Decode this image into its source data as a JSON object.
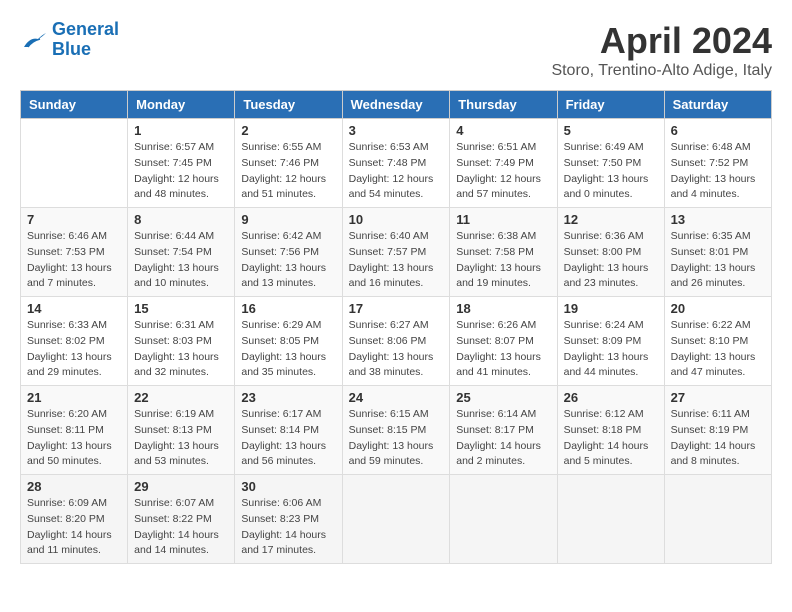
{
  "header": {
    "logo_line1": "General",
    "logo_line2": "Blue",
    "title": "April 2024",
    "subtitle": "Storo, Trentino-Alto Adige, Italy"
  },
  "weekdays": [
    "Sunday",
    "Monday",
    "Tuesday",
    "Wednesday",
    "Thursday",
    "Friday",
    "Saturday"
  ],
  "weeks": [
    [
      {
        "day": "",
        "info": ""
      },
      {
        "day": "1",
        "info": "Sunrise: 6:57 AM\nSunset: 7:45 PM\nDaylight: 12 hours\nand 48 minutes."
      },
      {
        "day": "2",
        "info": "Sunrise: 6:55 AM\nSunset: 7:46 PM\nDaylight: 12 hours\nand 51 minutes."
      },
      {
        "day": "3",
        "info": "Sunrise: 6:53 AM\nSunset: 7:48 PM\nDaylight: 12 hours\nand 54 minutes."
      },
      {
        "day": "4",
        "info": "Sunrise: 6:51 AM\nSunset: 7:49 PM\nDaylight: 12 hours\nand 57 minutes."
      },
      {
        "day": "5",
        "info": "Sunrise: 6:49 AM\nSunset: 7:50 PM\nDaylight: 13 hours\nand 0 minutes."
      },
      {
        "day": "6",
        "info": "Sunrise: 6:48 AM\nSunset: 7:52 PM\nDaylight: 13 hours\nand 4 minutes."
      }
    ],
    [
      {
        "day": "7",
        "info": "Sunrise: 6:46 AM\nSunset: 7:53 PM\nDaylight: 13 hours\nand 7 minutes."
      },
      {
        "day": "8",
        "info": "Sunrise: 6:44 AM\nSunset: 7:54 PM\nDaylight: 13 hours\nand 10 minutes."
      },
      {
        "day": "9",
        "info": "Sunrise: 6:42 AM\nSunset: 7:56 PM\nDaylight: 13 hours\nand 13 minutes."
      },
      {
        "day": "10",
        "info": "Sunrise: 6:40 AM\nSunset: 7:57 PM\nDaylight: 13 hours\nand 16 minutes."
      },
      {
        "day": "11",
        "info": "Sunrise: 6:38 AM\nSunset: 7:58 PM\nDaylight: 13 hours\nand 19 minutes."
      },
      {
        "day": "12",
        "info": "Sunrise: 6:36 AM\nSunset: 8:00 PM\nDaylight: 13 hours\nand 23 minutes."
      },
      {
        "day": "13",
        "info": "Sunrise: 6:35 AM\nSunset: 8:01 PM\nDaylight: 13 hours\nand 26 minutes."
      }
    ],
    [
      {
        "day": "14",
        "info": "Sunrise: 6:33 AM\nSunset: 8:02 PM\nDaylight: 13 hours\nand 29 minutes."
      },
      {
        "day": "15",
        "info": "Sunrise: 6:31 AM\nSunset: 8:03 PM\nDaylight: 13 hours\nand 32 minutes."
      },
      {
        "day": "16",
        "info": "Sunrise: 6:29 AM\nSunset: 8:05 PM\nDaylight: 13 hours\nand 35 minutes."
      },
      {
        "day": "17",
        "info": "Sunrise: 6:27 AM\nSunset: 8:06 PM\nDaylight: 13 hours\nand 38 minutes."
      },
      {
        "day": "18",
        "info": "Sunrise: 6:26 AM\nSunset: 8:07 PM\nDaylight: 13 hours\nand 41 minutes."
      },
      {
        "day": "19",
        "info": "Sunrise: 6:24 AM\nSunset: 8:09 PM\nDaylight: 13 hours\nand 44 minutes."
      },
      {
        "day": "20",
        "info": "Sunrise: 6:22 AM\nSunset: 8:10 PM\nDaylight: 13 hours\nand 47 minutes."
      }
    ],
    [
      {
        "day": "21",
        "info": "Sunrise: 6:20 AM\nSunset: 8:11 PM\nDaylight: 13 hours\nand 50 minutes."
      },
      {
        "day": "22",
        "info": "Sunrise: 6:19 AM\nSunset: 8:13 PM\nDaylight: 13 hours\nand 53 minutes."
      },
      {
        "day": "23",
        "info": "Sunrise: 6:17 AM\nSunset: 8:14 PM\nDaylight: 13 hours\nand 56 minutes."
      },
      {
        "day": "24",
        "info": "Sunrise: 6:15 AM\nSunset: 8:15 PM\nDaylight: 13 hours\nand 59 minutes."
      },
      {
        "day": "25",
        "info": "Sunrise: 6:14 AM\nSunset: 8:17 PM\nDaylight: 14 hours\nand 2 minutes."
      },
      {
        "day": "26",
        "info": "Sunrise: 6:12 AM\nSunset: 8:18 PM\nDaylight: 14 hours\nand 5 minutes."
      },
      {
        "day": "27",
        "info": "Sunrise: 6:11 AM\nSunset: 8:19 PM\nDaylight: 14 hours\nand 8 minutes."
      }
    ],
    [
      {
        "day": "28",
        "info": "Sunrise: 6:09 AM\nSunset: 8:20 PM\nDaylight: 14 hours\nand 11 minutes."
      },
      {
        "day": "29",
        "info": "Sunrise: 6:07 AM\nSunset: 8:22 PM\nDaylight: 14 hours\nand 14 minutes."
      },
      {
        "day": "30",
        "info": "Sunrise: 6:06 AM\nSunset: 8:23 PM\nDaylight: 14 hours\nand 17 minutes."
      },
      {
        "day": "",
        "info": ""
      },
      {
        "day": "",
        "info": ""
      },
      {
        "day": "",
        "info": ""
      },
      {
        "day": "",
        "info": ""
      }
    ]
  ]
}
